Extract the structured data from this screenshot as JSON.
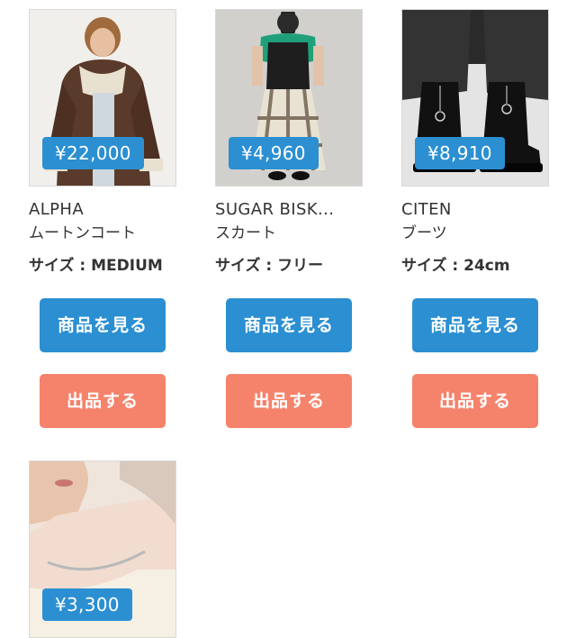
{
  "items": [
    {
      "price": "¥22,000",
      "brand": "ALPHA",
      "category": "ムートンコート",
      "size": "サイズ : MEDIUM",
      "view_label": "商品を見る",
      "sell_label": "出品する"
    },
    {
      "price": "¥4,960",
      "brand": "SUGAR BISK...",
      "category": "スカート",
      "size": "サイズ : フリー",
      "view_label": "商品を見る",
      "sell_label": "出品する"
    },
    {
      "price": "¥8,910",
      "brand": "CITEN",
      "category": "ブーツ",
      "size": "サイズ : 24cm",
      "view_label": "商品を見る",
      "sell_label": "出品する"
    },
    {
      "price": "¥3,300"
    }
  ],
  "colors": {
    "primary": "#2b8fd2",
    "sell": "#f5836b",
    "text": "#333333"
  }
}
